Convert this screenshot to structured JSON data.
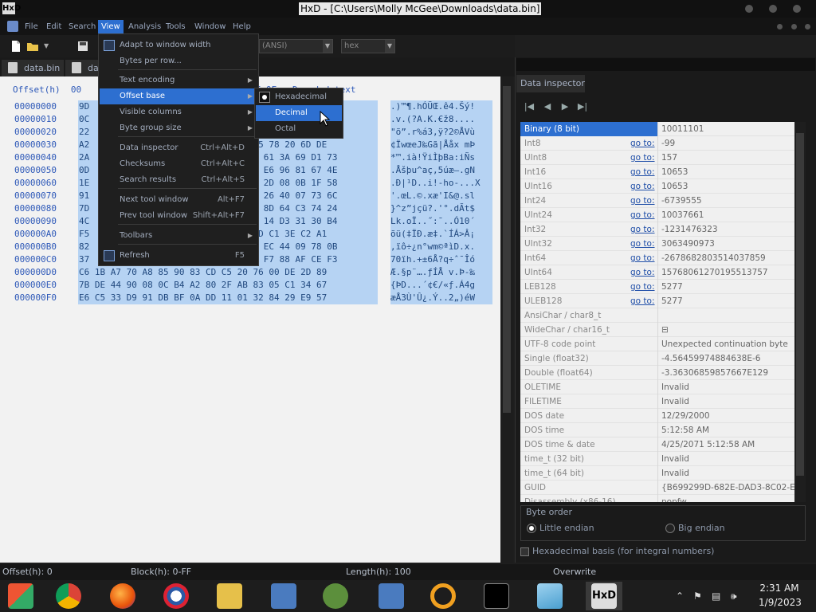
{
  "window": {
    "title": "HxD - [C:\\Users\\Molly McGee\\Downloads\\data.bin]",
    "app_icon": "HxD"
  },
  "menubar": [
    "File",
    "Edit",
    "Search",
    "View",
    "Analysis",
    "Tools",
    "Window",
    "Help"
  ],
  "toolbar": {
    "encoding_value": "(ANSI)",
    "base_value": "hex"
  },
  "tabs": [
    "data.bin",
    "dat"
  ],
  "hex": {
    "header": "Offset(h)  00                                0E 0F   Decoded text",
    "rows": [
      {
        "offset": "00000000",
        "bytes": "9D                                    FD 21",
        "text": ".)™¶.hÓÜŒ.ê4.Šý!"
      },
      {
        "offset": "00000010",
        "bytes": "0C                                    08 06",
        "text": ".v.(?A.K.€ž8...."
      },
      {
        "offset": "00000020",
        "bytes": "22                                    56 F9",
        "text": "\"õ”.r%á3,ÿ?2©ÅVù"
      },
      {
        "offset": "00000030",
        "bytes": "A2                            C3 E5 78 20 6D DE",
        "text": "¢ÏwœeJ‰Gã|Ååx mÞ"
      },
      {
        "offset": "00000040",
        "bytes": "2A                            E 42 61 3A 69 D1 73",
        "text": "*™.ià!ŸiÌþBa:iÑs"
      },
      {
        "offset": "00000050",
        "bytes": "0D                            5 FA E6 96 81 67 4E",
        "text": ".Åšþu^aç,5úæ–.gN"
      },
      {
        "offset": "00000060",
        "bytes": "1E                            8 6F 2D 08 0B 1F 58",
        "text": ".Ð|¹D..i!-ho-...X"
      },
      {
        "offset": "00000070",
        "bytes": "91                            7 49 26 40 07 73 6C",
        "text": "'.œL.©.xæ'I&@.sl"
      },
      {
        "offset": "00000080",
        "bytes": "7D                            7 BA 8D 64 C3 74 24",
        "text": "}^z”jçü?.'°.dÃt$"
      },
      {
        "offset": "00000090",
        "bytes": "4C                            F 0D 14 D3 31 30 B4",
        "text": "Lk.oÏ..˝:¯..Ó10´"
      },
      {
        "offset": "000000A0",
        "bytes": "F5                            60 CD C1 3E C2 A1",
        "text": "õü(‡ÏÐ.æ‡.`ÍÁ>Â¡"
      },
      {
        "offset": "000000B0",
        "bytes": "82                            9 AA EC 44 09 78 0B",
        "text": ",ïô÷¿n°wm©ªìD.x."
      },
      {
        "offset": "000000C0",
        "bytes": "37                            F 71 F7 88 AF CE F3",
        "text": "70ïh.+±6Å?q÷ˆ¯Îó"
      },
      {
        "offset": "000000D0",
        "bytes": "C6 1B A7 70 A8 85 90 83 CD C5 20 76 00 DE 2D 89",
        "text": "Æ.§p¨….ƒÍÅ v.Þ-‰"
      },
      {
        "offset": "000000E0",
        "bytes": "7B DE 44 90 08 0C B4 A2 80 2F AB 83 05 C1 34 67",
        "text": "{ÞD...´¢€/«ƒ.Á4g"
      },
      {
        "offset": "000000F0",
        "bytes": "E6 C5 33 D9 91 DB BF 0A DD 11 01 32 84 29 E9 57",
        "text": "æÅ3Ù'Û¿.Ý..2„)éW"
      }
    ]
  },
  "view_menu": {
    "items": [
      {
        "label": "Adapt to window width",
        "shortcut": "",
        "submenu": false,
        "icon": "window-width-icon"
      },
      {
        "label": "Bytes per row...",
        "shortcut": "",
        "submenu": false,
        "icon": ""
      },
      {
        "label": "Text encoding",
        "shortcut": "",
        "submenu": true,
        "icon": ""
      },
      {
        "label": "Offset base",
        "shortcut": "",
        "submenu": true,
        "icon": ""
      },
      {
        "label": "Visible columns",
        "shortcut": "",
        "submenu": true,
        "icon": ""
      },
      {
        "label": "Byte group size",
        "shortcut": "",
        "submenu": true,
        "icon": ""
      },
      {
        "label": "Data inspector",
        "shortcut": "Ctrl+Alt+D",
        "submenu": false,
        "icon": ""
      },
      {
        "label": "Checksums",
        "shortcut": "Ctrl+Alt+C",
        "submenu": false,
        "icon": ""
      },
      {
        "label": "Search results",
        "shortcut": "Ctrl+Alt+S",
        "submenu": false,
        "icon": ""
      },
      {
        "label": "Next tool window",
        "shortcut": "Alt+F7",
        "submenu": false,
        "icon": ""
      },
      {
        "label": "Prev tool window",
        "shortcut": "Shift+Alt+F7",
        "submenu": false,
        "icon": ""
      },
      {
        "label": "Toolbars",
        "shortcut": "",
        "submenu": true,
        "icon": ""
      },
      {
        "label": "Refresh",
        "shortcut": "F5",
        "submenu": false,
        "icon": "refresh-icon"
      }
    ]
  },
  "offset_submenu": {
    "items": [
      "Hexadecimal",
      "Decimal",
      "Octal"
    ],
    "checked": "Hexadecimal",
    "highlighted": "Decimal"
  },
  "data_inspector": {
    "tab": "Data inspector",
    "goto_label": "go to:",
    "rows": [
      {
        "name": "Binary (8 bit)",
        "value": "10011101",
        "goto": false
      },
      {
        "name": "Int8",
        "value": "-99",
        "goto": true
      },
      {
        "name": "UInt8",
        "value": "157",
        "goto": true
      },
      {
        "name": "Int16",
        "value": "10653",
        "goto": true
      },
      {
        "name": "UInt16",
        "value": "10653",
        "goto": true
      },
      {
        "name": "Int24",
        "value": "-6739555",
        "goto": true
      },
      {
        "name": "UInt24",
        "value": "10037661",
        "goto": true
      },
      {
        "name": "Int32",
        "value": "-1231476323",
        "goto": true
      },
      {
        "name": "UInt32",
        "value": "3063490973",
        "goto": true
      },
      {
        "name": "Int64",
        "value": "-2678682803514037859",
        "goto": true
      },
      {
        "name": "UInt64",
        "value": "15768061270195513757",
        "goto": true
      },
      {
        "name": "LEB128",
        "value": "5277",
        "goto": true
      },
      {
        "name": "ULEB128",
        "value": "5277",
        "goto": true
      },
      {
        "name": "AnsiChar / char8_t",
        "value": "",
        "goto": false
      },
      {
        "name": "WideChar / char16_t",
        "value": "⊟",
        "goto": false
      },
      {
        "name": "UTF-8 code point",
        "value": "Unexpected continuation byte",
        "goto": false
      },
      {
        "name": "Single (float32)",
        "value": "-4.56459974884638E-6",
        "goto": false
      },
      {
        "name": "Double (float64)",
        "value": "-3.36306859857667E129",
        "goto": false
      },
      {
        "name": "OLETIME",
        "value": "Invalid",
        "goto": false
      },
      {
        "name": "FILETIME",
        "value": "Invalid",
        "goto": false
      },
      {
        "name": "DOS date",
        "value": "12/29/2000",
        "goto": false
      },
      {
        "name": "DOS time",
        "value": "5:12:58 AM",
        "goto": false
      },
      {
        "name": "DOS time & date",
        "value": "4/25/2071 5:12:58 AM",
        "goto": false
      },
      {
        "name": "time_t (32 bit)",
        "value": "Invalid",
        "goto": false
      },
      {
        "name": "time_t (64 bit)",
        "value": "Invalid",
        "goto": false
      },
      {
        "name": "GUID",
        "value": "{B699299D-682E-DAD3-8C02-EA3",
        "goto": false
      },
      {
        "name": "Disassembly (x86-16)",
        "value": "popfw",
        "goto": false
      }
    ],
    "byte_order_label": "Byte order",
    "little_endian": "Little endian",
    "big_endian": "Big endian",
    "selected_byte_order": "Little endian",
    "hex_basis": "Hexadecimal basis (for integral numbers)"
  },
  "status": {
    "offset": "Offset(h): 0",
    "block": "Block(h): 0-FF",
    "length": "Length(h): 100",
    "mode": "Overwrite"
  },
  "taskbar": {
    "icons": [
      "windows-start-icon",
      "chrome-icon",
      "firefox-icon",
      "obama-logo-icon",
      "file-explorer-icon",
      "network-computer-icon",
      "people-icon",
      "network-computer-icon",
      "search-magnifier-icon",
      "terminal-icon",
      "notepad-icon",
      "hxd-icon"
    ],
    "time": "2:31 AM",
    "date": "1/9/2023"
  },
  "colors": {
    "accent": "#2d6fd0",
    "hex_selection": "#b6d3f3",
    "offset_blue": "#2d58b8"
  }
}
